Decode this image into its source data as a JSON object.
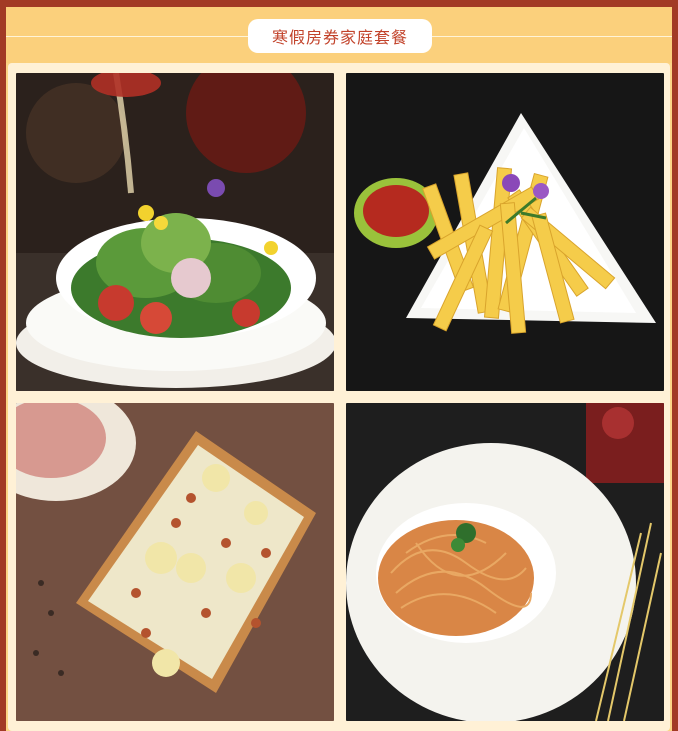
{
  "header": {
    "title": "寒假房券家庭套餐"
  },
  "gallery": {
    "items": [
      {
        "name": "salad-photo",
        "icon": "salad-image"
      },
      {
        "name": "fries-photo",
        "icon": "fries-image"
      },
      {
        "name": "pizza-photo",
        "icon": "pizza-image"
      },
      {
        "name": "spaghetti-photo",
        "icon": "spaghetti-image"
      }
    ]
  },
  "colors": {
    "border": "#a23a25",
    "band": "#fbd07c",
    "panel": "#fff1d6",
    "title_text": "#c2432b"
  }
}
